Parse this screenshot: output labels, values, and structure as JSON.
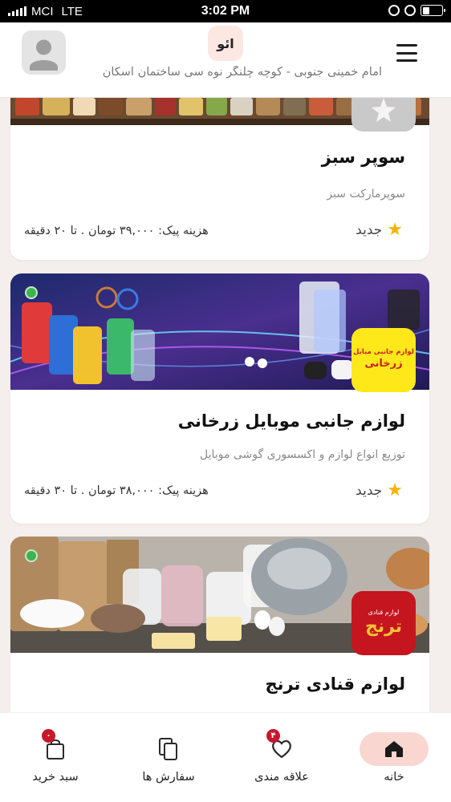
{
  "status_bar": {
    "carrier": "MCI",
    "network": "LTE",
    "time": "3:02 PM"
  },
  "header": {
    "logo_text": "ائو",
    "address": "امام خمینی جنوبی - کوچه چلنگر نوه سی ساختمان اسکان",
    "menu_icon": "hamburger-icon",
    "avatar_icon": "user-avatar-icon"
  },
  "stores": [
    {
      "name": "سوپر سبز",
      "description": "سوپرمارکت سبز",
      "rating_label": "جدید",
      "delivery": "هزینه پیک: ۳۹,۰۰۰ تومان . تا ۲۰ دقیقه",
      "open": false
    },
    {
      "name": "لوازم جانبی موبایل زرخانی",
      "description": "توزیع انواع لوازم و اکسسوری گوشی موبایل",
      "rating_label": "جدید",
      "delivery": "هزینه پیک: ۳۸,۰۰۰ تومان . تا ۳۰ دقیقه",
      "logo_line1": "لوازم جانبی مبایل",
      "logo_line2": "زرخانی",
      "open": true
    },
    {
      "name": "لوازم قنادی ترنج",
      "description": "",
      "rating_label": "",
      "delivery": "",
      "logo_line1": "لوازم قنادی",
      "logo_line2": "ترنج",
      "open": true
    }
  ],
  "bottom_nav": [
    {
      "label": "خانه",
      "icon": "home-icon",
      "active": true
    },
    {
      "label": "علاقه مندی",
      "icon": "heart-icon",
      "badge": "۴"
    },
    {
      "label": "سفارش ها",
      "icon": "orders-icon"
    },
    {
      "label": "سبد خرید",
      "icon": "shopping-bag-icon",
      "badge": "۰"
    }
  ],
  "colors": {
    "accent": "#fad6d0",
    "badge": "#c8182c",
    "open_dot": "#3fb34f",
    "star": "#f4b400",
    "background": "#f4eeec"
  }
}
